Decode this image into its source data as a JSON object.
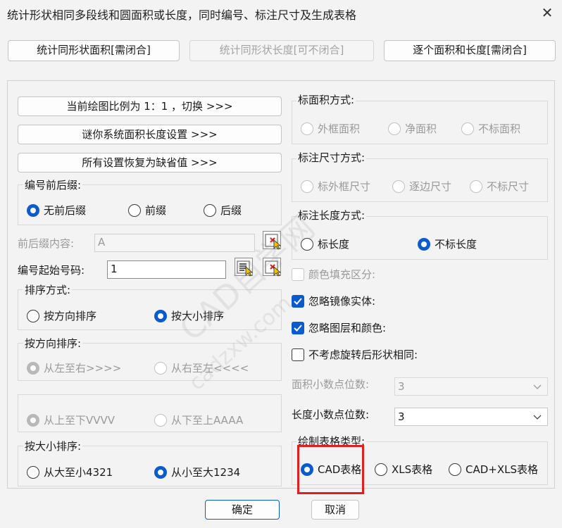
{
  "dialog": {
    "title": "统计形状相同多段线和圆面积或长度，同时编号、标注尺寸及生成表格",
    "close": "✕"
  },
  "top_buttons": [
    {
      "label": "统计同形状面积[需闭合]",
      "enabled": true
    },
    {
      "label": "统计同形状长度[可不闭合]",
      "enabled": false
    },
    {
      "label": "逐个面积和长度[需闭合]",
      "enabled": true
    }
  ],
  "left": {
    "scale_button": "当前绘图比例为 1：1 ，切换    >>>",
    "mini_button": "谜你系统面积长度设置    >>>",
    "reset_button": "所有设置恢复为缺省值    >>>",
    "prefix_group": {
      "title": "编号前后缀:",
      "options": [
        "无前后缀",
        "前缀",
        "后缀"
      ],
      "selected": 0
    },
    "prefix_content": {
      "label": "前后缀内容:",
      "value": "A"
    },
    "start_no": {
      "label": "编号起始号码:",
      "value": "1"
    },
    "sort_group": {
      "title": "排序方式:",
      "options": [
        "按方向排序",
        "按大小排序"
      ],
      "selected": 1
    },
    "dir_group": {
      "title": "按方向排序:",
      "row1": [
        "从左至右>>>>",
        "从右至左<<<<"
      ],
      "row2": [
        "从上至下VVVV",
        "从下至上AAAA"
      ],
      "selected": 0
    },
    "size_group": {
      "title": "按大小排序:",
      "options": [
        "从大至小4321",
        "从小至大1234"
      ],
      "selected": 1
    }
  },
  "right": {
    "area_mark": {
      "title": "标面积方式:",
      "options": [
        "外框面积",
        "净面积",
        "不标面积"
      ]
    },
    "dim_mark": {
      "title": "标注尺寸方式:",
      "options": [
        "标外框尺寸",
        "逐边尺寸",
        "不标尺寸"
      ]
    },
    "len_mark": {
      "title": "标注长度方式:",
      "options": [
        "标长度",
        "不标长度"
      ],
      "selected": 1
    },
    "checks": [
      {
        "label": "颜色填充区分:",
        "checked": false,
        "enabled": false
      },
      {
        "label": "忽略镜像实体:",
        "checked": true,
        "enabled": true
      },
      {
        "label": "忽略图层和颜色:",
        "checked": true,
        "enabled": true
      },
      {
        "label": "不考虑旋转后形状相同:",
        "checked": false,
        "enabled": true
      }
    ],
    "area_decimals": {
      "label": "面积小数点位数:",
      "value": "3"
    },
    "len_decimals": {
      "label": "长度小数点位数:",
      "value": "3"
    },
    "table_type": {
      "title": "绘制表格类型:",
      "options": [
        "CAD表格",
        "XLS表格",
        "CAD+XLS表格"
      ],
      "selected": 0
    }
  },
  "footer": {
    "ok": "确定",
    "cancel": "取消"
  },
  "watermark": {
    "text1": "CAD自学网",
    "text2": "cadzxw.com"
  },
  "colors": {
    "accent": "#0a5ad0",
    "highlight": "#e02020"
  }
}
